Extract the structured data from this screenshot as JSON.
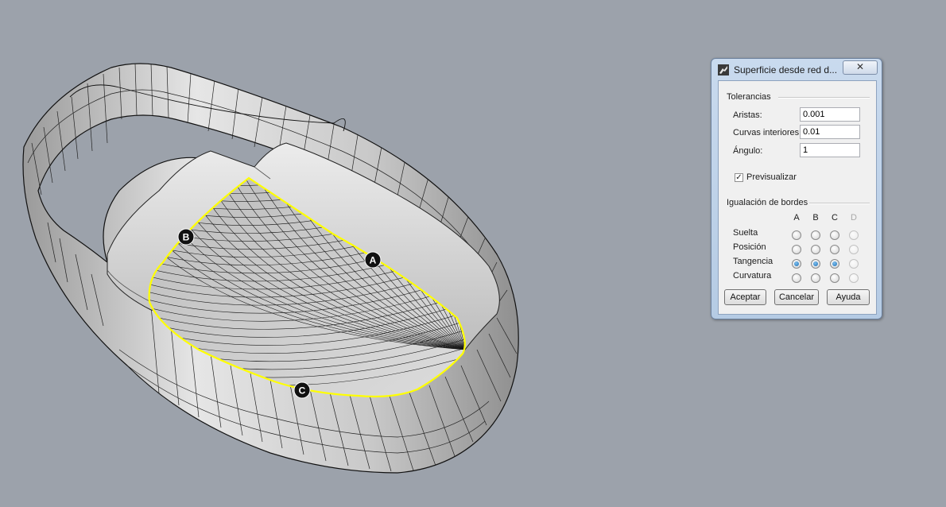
{
  "viewport": {
    "markers": [
      "A",
      "B",
      "C"
    ],
    "colors": {
      "background": "#9ca2ab",
      "surface": "#d9d9d9",
      "edge_highlight": "#ffff00"
    }
  },
  "dialog": {
    "title": "Superficie desde red d...",
    "close_symbol": "✕",
    "tolerances": {
      "group_label": "Tolerancias",
      "edges_label": "Aristas:",
      "edges_value": "0.001",
      "interior_label": "Curvas interiores:",
      "interior_value": "0.01",
      "angle_label": "Ángulo:",
      "angle_value": "1"
    },
    "preview": {
      "label": "Previsualizar",
      "checked": true
    },
    "edge_matching": {
      "group_label": "Igualación de bordes",
      "columns": [
        "A",
        "B",
        "C",
        "D"
      ],
      "rows": [
        {
          "label": "Suelta"
        },
        {
          "label": "Posición"
        },
        {
          "label": "Tangencia"
        },
        {
          "label": "Curvatura"
        }
      ],
      "selected_row": "Tangencia",
      "column_d_enabled": false
    },
    "buttons": {
      "ok": "Aceptar",
      "cancel": "Cancelar",
      "help": "Ayuda"
    }
  }
}
